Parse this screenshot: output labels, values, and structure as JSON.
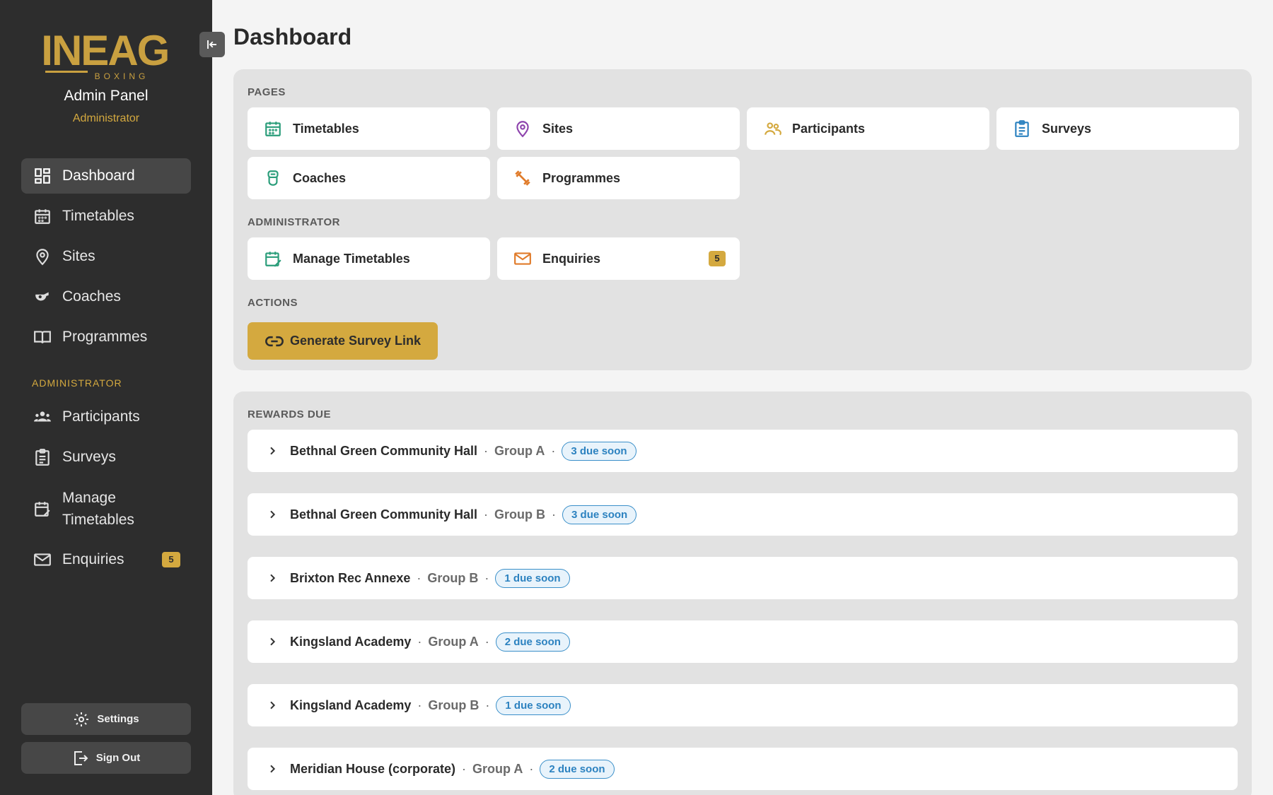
{
  "sidebar": {
    "logo_text": "LINEAGE",
    "logo_sub": "BOXING",
    "title": "Admin Panel",
    "role": "Administrator",
    "items": [
      {
        "label": "Dashboard",
        "icon": "dashboard-icon"
      },
      {
        "label": "Timetables",
        "icon": "calendar-icon"
      },
      {
        "label": "Sites",
        "icon": "location-pin-icon"
      },
      {
        "label": "Coaches",
        "icon": "whistle-icon"
      },
      {
        "label": "Programmes",
        "icon": "book-icon"
      }
    ],
    "admin_section": "ADMINISTRATOR",
    "admin_items": [
      {
        "label": "Participants",
        "icon": "people-icon"
      },
      {
        "label": "Surveys",
        "icon": "clipboard-icon"
      },
      {
        "label": "Manage Timetables",
        "icon": "calendar-edit-icon"
      },
      {
        "label": "Enquiries",
        "icon": "mail-icon",
        "badge": "5"
      }
    ],
    "settings_label": "Settings",
    "signout_label": "Sign Out"
  },
  "header": {
    "title": "Dashboard"
  },
  "pages_panel": {
    "pages_label": "PAGES",
    "pages": [
      {
        "label": "Timetables",
        "icon": "calendar-icon",
        "color": "#2a9d7a"
      },
      {
        "label": "Sites",
        "icon": "location-pin-icon",
        "color": "#8e44ad"
      },
      {
        "label": "Participants",
        "icon": "people-icon",
        "color": "#d4a93f"
      },
      {
        "label": "Surveys",
        "icon": "clipboard-icon",
        "color": "#2c82c0"
      },
      {
        "label": "Coaches",
        "icon": "whistle-icon",
        "color": "#2a9d7a"
      },
      {
        "label": "Programmes",
        "icon": "dumbbell-icon",
        "color": "#e07b2a"
      }
    ],
    "admin_label": "ADMINISTRATOR",
    "admin_pages": [
      {
        "label": "Manage Timetables",
        "icon": "calendar-edit-icon",
        "color": "#2a9d7a"
      },
      {
        "label": "Enquiries",
        "icon": "mail-icon",
        "color": "#e07b2a",
        "badge": "5"
      }
    ],
    "actions_label": "ACTIONS",
    "generate_label": "Generate Survey Link"
  },
  "rewards_panel": {
    "label": "REWARDS DUE",
    "rows": [
      {
        "site": "Bethnal Green Community Hall",
        "group": "Group A",
        "due": "3 due soon"
      },
      {
        "site": "Bethnal Green Community Hall",
        "group": "Group B",
        "due": "3 due soon"
      },
      {
        "site": "Brixton Rec Annexe",
        "group": "Group B",
        "due": "1 due soon"
      },
      {
        "site": "Kingsland Academy",
        "group": "Group A",
        "due": "2 due soon"
      },
      {
        "site": "Kingsland Academy",
        "group": "Group B",
        "due": "1 due soon"
      },
      {
        "site": "Meridian House (corporate)",
        "group": "Group A",
        "due": "2 due soon"
      }
    ]
  },
  "colors": {
    "accent": "#d4a93f",
    "sidebar": "#2d2d2d",
    "due": "#2c82c0"
  }
}
